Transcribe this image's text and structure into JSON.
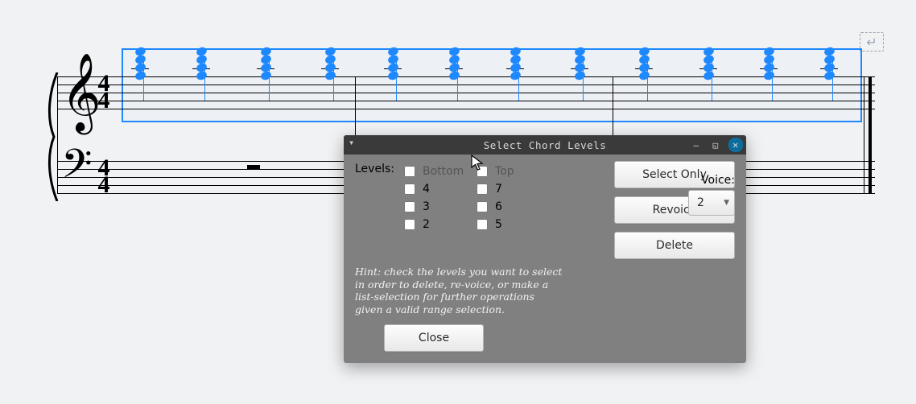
{
  "dialog": {
    "title": "Select Chord Levels",
    "levels_label": "Levels:",
    "checks_left": [
      {
        "label": "Bottom",
        "checked": false,
        "muted": true
      },
      {
        "label": "4",
        "checked": false
      },
      {
        "label": "3",
        "checked": false
      },
      {
        "label": "2",
        "checked": false
      }
    ],
    "checks_right": [
      {
        "label": "Top",
        "checked": false,
        "muted": true
      },
      {
        "label": "7",
        "checked": false
      },
      {
        "label": "6",
        "checked": false
      },
      {
        "label": "5",
        "checked": false
      }
    ],
    "actions": {
      "select_only": "Select Only",
      "revoice": "Revoice",
      "delete": "Delete"
    },
    "voice_label": "Voice:",
    "voice_value": "2",
    "hint": "Hint: check the levels you want to select in order to delete, re-voice, or make a list-selection for further operations given a valid range selection.",
    "close": "Close"
  },
  "score": {
    "time_signature": {
      "num": "4",
      "den": "4"
    },
    "treble_clef": "𝄞",
    "bass_clef": "𝄢",
    "end_marker": "↵",
    "chord_positions": [
      94,
      170,
      250,
      330,
      408,
      484,
      560,
      640,
      720,
      800,
      875,
      950
    ],
    "bass_rest_positions": [
      236
    ],
    "barlines_full": [
      370,
      690,
      1002,
      1008
    ],
    "barlines_start": 0
  }
}
